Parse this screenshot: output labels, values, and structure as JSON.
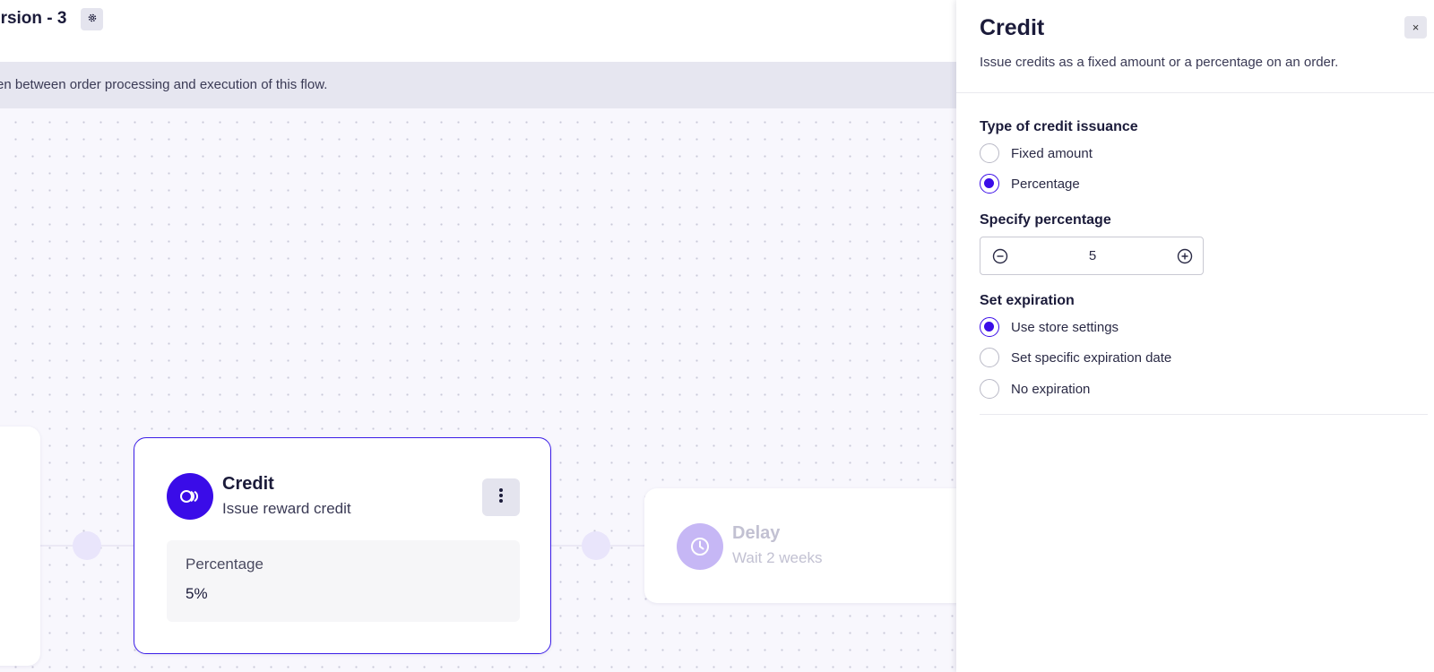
{
  "header": {
    "flow_title": "ersion - 3",
    "settings_icon": "gear-icon"
  },
  "banner": {
    "text": "en between order processing and execution of this flow."
  },
  "canvas": {
    "credit_node": {
      "title": "Credit",
      "subtitle": "Issue reward credit",
      "detail_label": "Percentage",
      "detail_value": "5%",
      "icon": "credit-icon",
      "menu_icon": "more-vertical-icon",
      "accent_color": "#3a0ce8"
    },
    "delay_node": {
      "title": "Delay",
      "subtitle": "Wait 2 weeks",
      "icon": "clock-icon"
    }
  },
  "panel": {
    "title": "Credit",
    "close_label": "×",
    "description": "Issue credits as a fixed amount or a percentage on an order.",
    "issuance": {
      "label": "Type of credit issuance",
      "options": [
        {
          "label": "Fixed amount",
          "checked": false
        },
        {
          "label": "Percentage",
          "checked": true
        }
      ]
    },
    "percentage": {
      "label": "Specify percentage",
      "value": "5",
      "minus_icon": "minus-circle-icon",
      "plus_icon": "plus-circle-icon"
    },
    "expiration": {
      "label": "Set expiration",
      "options": [
        {
          "label": "Use store settings",
          "checked": true
        },
        {
          "label": "Set specific expiration date",
          "checked": false
        },
        {
          "label": "No expiration",
          "checked": false
        }
      ]
    }
  }
}
